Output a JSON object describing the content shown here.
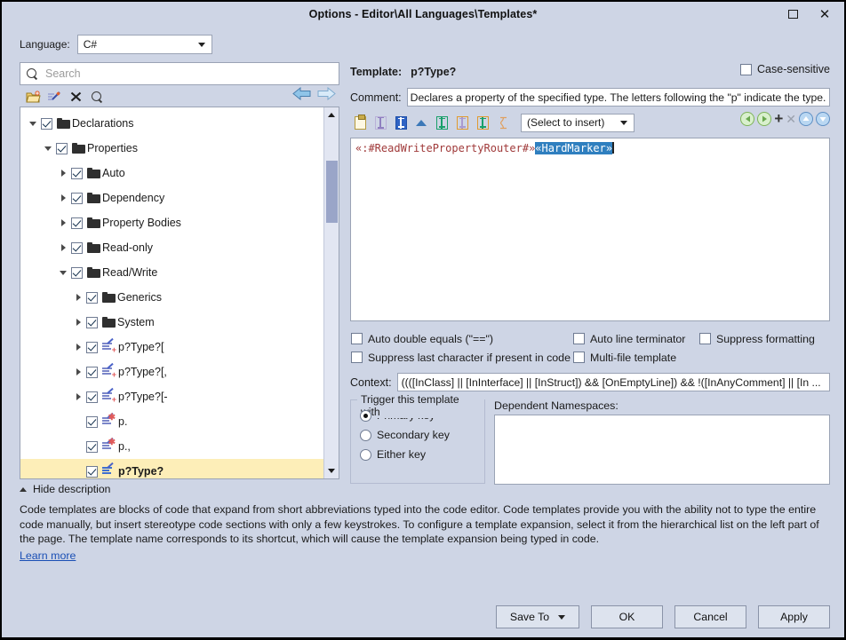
{
  "window": {
    "title": "Options - Editor\\All Languages\\Templates*",
    "restore_label": "Restore",
    "close_label": "Close"
  },
  "language": {
    "label": "Language:",
    "value": "C#"
  },
  "search": {
    "placeholder": "Search",
    "icon": "search-icon"
  },
  "tree_toolbar": {
    "new_folder": "new-folder-icon",
    "new_template": "new-template-icon",
    "delete": "delete-icon",
    "find": "find-icon",
    "back": "back-arrow-icon",
    "forward": "forward-arrow-icon"
  },
  "tree": {
    "items": [
      {
        "label": "Declarations",
        "indent": 0,
        "expander": "expanded",
        "icon": "folder",
        "checked": true,
        "selected": false
      },
      {
        "label": "Properties",
        "indent": 1,
        "expander": "expanded",
        "icon": "folder",
        "checked": true,
        "selected": false
      },
      {
        "label": "Auto",
        "indent": 2,
        "expander": "collapsed",
        "icon": "folder",
        "checked": true,
        "selected": false
      },
      {
        "label": "Dependency",
        "indent": 2,
        "expander": "collapsed",
        "icon": "folder",
        "checked": true,
        "selected": false
      },
      {
        "label": "Property Bodies",
        "indent": 2,
        "expander": "collapsed",
        "icon": "folder",
        "checked": true,
        "selected": false
      },
      {
        "label": "Read-only",
        "indent": 2,
        "expander": "collapsed",
        "icon": "folder",
        "checked": true,
        "selected": false
      },
      {
        "label": "Read/Write",
        "indent": 2,
        "expander": "expanded",
        "icon": "folder",
        "checked": true,
        "selected": false
      },
      {
        "label": "Generics",
        "indent": 3,
        "expander": "collapsed",
        "icon": "folder",
        "checked": true,
        "selected": false
      },
      {
        "label": "System",
        "indent": 3,
        "expander": "collapsed",
        "icon": "folder",
        "checked": true,
        "selected": false
      },
      {
        "label": "p?Type?[",
        "indent": 3,
        "expander": "collapsed",
        "icon": "template-plus",
        "checked": true,
        "selected": false
      },
      {
        "label": "p?Type?[,",
        "indent": 3,
        "expander": "collapsed",
        "icon": "template-plus",
        "checked": true,
        "selected": false
      },
      {
        "label": "p?Type?[-",
        "indent": 3,
        "expander": "collapsed",
        "icon": "template-plus",
        "checked": true,
        "selected": false
      },
      {
        "label": "p.",
        "indent": 3,
        "expander": "none",
        "icon": "template-star",
        "checked": true,
        "selected": false
      },
      {
        "label": "p.,",
        "indent": 3,
        "expander": "none",
        "icon": "template-star",
        "checked": true,
        "selected": false
      },
      {
        "label": "p?Type?",
        "indent": 3,
        "expander": "none",
        "icon": "template-blue",
        "checked": true,
        "selected": true
      }
    ]
  },
  "template": {
    "label": "Template:",
    "name": "p?Type?",
    "case_sensitive_label": "Case-sensitive",
    "case_sensitive_checked": false,
    "comment_label": "Comment:",
    "comment_value": "Declares a property of the specified type. The letters following the \"p\" indicate the type."
  },
  "editor_toolbar": {
    "buttons": [
      "clipboard-icon",
      "editable-marker-icon",
      "hotspot-marker-icon",
      "triangle-up-icon",
      "green-marker-icon",
      "orange-marker-icon",
      "orange-green-marker-icon",
      "hard-marker-icon"
    ],
    "insert_select_value": "(Select to insert)",
    "right_buttons": [
      "prev-occurrence-icon",
      "next-occurrence-icon",
      "add-icon",
      "remove-icon",
      "move-up-icon",
      "move-down-icon"
    ]
  },
  "code": {
    "prefix": "«:#ReadWritePropertyRouter#»",
    "selected": "«HardMarker»"
  },
  "options": {
    "auto_double_equals": {
      "label": "Auto double equals (\"==\")",
      "checked": false
    },
    "auto_line_terminator": {
      "label": "Auto line terminator",
      "checked": false
    },
    "suppress_formatting": {
      "label": "Suppress formatting",
      "checked": false
    },
    "suppress_last_character": {
      "label": "Suppress last character if present in code",
      "checked": false
    },
    "multi_file_template": {
      "label": "Multi-file template",
      "checked": false
    }
  },
  "context": {
    "label": "Context:",
    "value": "((([InClass] || [InInterface] || [InStruct]) && [OnEmptyLine]) && !([InAnyComment] || [In  ..."
  },
  "trigger": {
    "group_title": "Trigger this template with",
    "options": [
      {
        "label": "Primary key",
        "selected": true
      },
      {
        "label": "Secondary key",
        "selected": false
      },
      {
        "label": "Either key",
        "selected": false
      }
    ]
  },
  "dependent_namespaces": {
    "label": "Dependent Namespaces:",
    "value": ""
  },
  "description": {
    "toggle_label": "Hide description",
    "body": "Code templates are blocks of code that expand from short abbreviations typed into the code editor. Code templates provide you with the ability not to type the entire code manually, but insert stereotype code sections with only a few keystrokes. To configure a template expansion, select it from the hierarchical list on the left part of the page. The template name corresponds to its shortcut, which will cause the template expansion being typed in code.",
    "learn_more": "Learn more"
  },
  "footer": {
    "save_to": "Save To",
    "ok": "OK",
    "cancel": "Cancel",
    "apply": "Apply"
  },
  "colors": {
    "dialog_bg": "#ced5e5",
    "selection_row": "#fdeeb8",
    "code_text": "#a03a3a",
    "code_selection": "#2f7fbf",
    "link": "#1a4fb5"
  }
}
